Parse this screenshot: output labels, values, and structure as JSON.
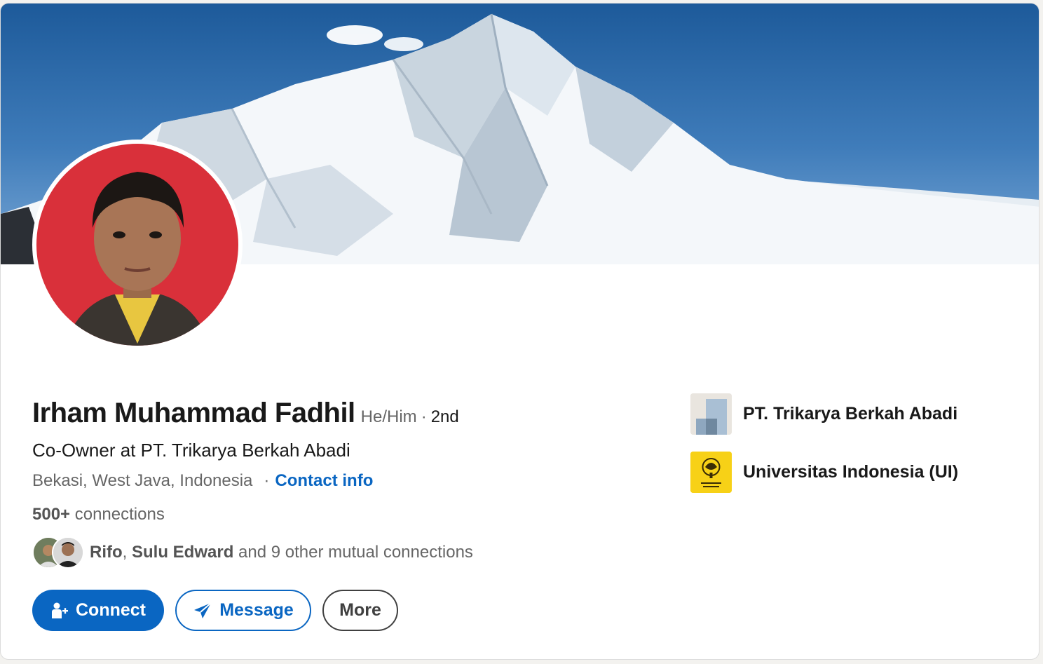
{
  "profile": {
    "name": "Irham Muhammad Fadhil",
    "pronouns": "He/Him",
    "degree_separator": "·",
    "degree": "2nd",
    "headline": "Co-Owner at PT. Trikarya Berkah Abadi",
    "location": "Bekasi, West Java, Indonesia",
    "location_separator": "·",
    "contact_info_label": "Contact info",
    "connections_count": "500+",
    "connections_label": "connections",
    "mutual": {
      "names_first": "Rifo",
      "comma": ",",
      "names_second": "Sulu Edward",
      "rest": "and 9 other mutual connections"
    }
  },
  "actions": {
    "connect_label": "Connect",
    "message_label": "Message",
    "more_label": "More"
  },
  "experience": [
    {
      "label": "PT. Trikarya Berkah Abadi",
      "icon": "company-logo-icon"
    },
    {
      "label": "Universitas Indonesia (UI)",
      "icon": "university-logo-icon"
    }
  ],
  "colors": {
    "accent": "#0a66c2",
    "avatar_background": "#d9303a",
    "university_logo": "#f7d117"
  }
}
